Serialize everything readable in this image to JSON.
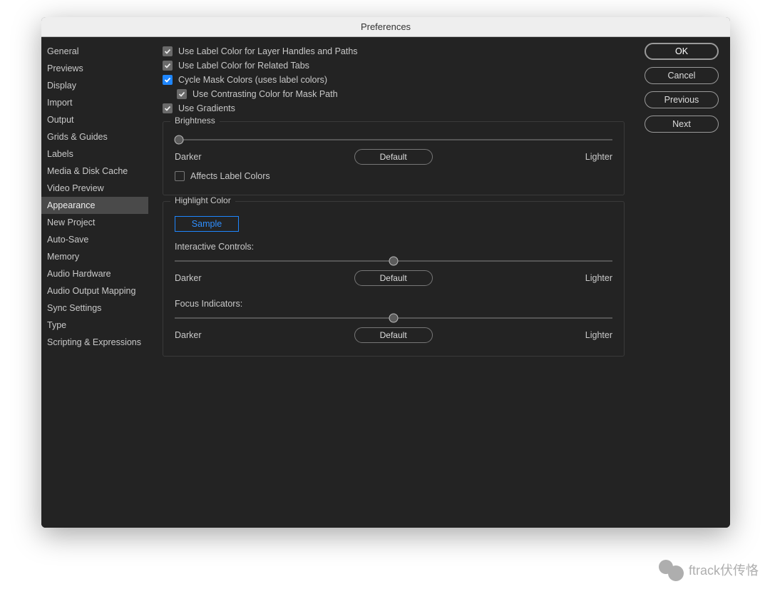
{
  "window": {
    "title": "Preferences"
  },
  "sidebar": {
    "items": [
      {
        "label": "General"
      },
      {
        "label": "Previews"
      },
      {
        "label": "Display"
      },
      {
        "label": "Import"
      },
      {
        "label": "Output"
      },
      {
        "label": "Grids & Guides"
      },
      {
        "label": "Labels"
      },
      {
        "label": "Media & Disk Cache"
      },
      {
        "label": "Video Preview"
      },
      {
        "label": "Appearance"
      },
      {
        "label": "New Project"
      },
      {
        "label": "Auto-Save"
      },
      {
        "label": "Memory"
      },
      {
        "label": "Audio Hardware"
      },
      {
        "label": "Audio Output Mapping"
      },
      {
        "label": "Sync Settings"
      },
      {
        "label": "Type"
      },
      {
        "label": "Scripting & Expressions"
      }
    ],
    "selected_index": 9
  },
  "buttons": {
    "ok": "OK",
    "cancel": "Cancel",
    "previous": "Previous",
    "next": "Next"
  },
  "checkboxes": {
    "label_handles": {
      "label": "Use Label Color for Layer Handles and Paths",
      "checked": true,
      "style": "gray"
    },
    "label_tabs": {
      "label": "Use Label Color for Related Tabs",
      "checked": true,
      "style": "gray"
    },
    "cycle_mask": {
      "label": "Cycle Mask Colors (uses label colors)",
      "checked": true,
      "style": "blue"
    },
    "contrast_mask": {
      "label": "Use Contrasting Color for Mask Path",
      "checked": true,
      "style": "gray"
    },
    "gradients": {
      "label": "Use Gradients",
      "checked": true,
      "style": "gray"
    },
    "affects_label": {
      "label": "Affects Label Colors",
      "checked": false
    }
  },
  "brightness": {
    "legend": "Brightness",
    "darker": "Darker",
    "lighter": "Lighter",
    "default": "Default",
    "value_percent": 1
  },
  "highlight": {
    "legend": "Highlight Color",
    "sample": "Sample",
    "interactive_label": "Interactive Controls:",
    "focus_label": "Focus Indicators:",
    "darker": "Darker",
    "lighter": "Lighter",
    "default": "Default",
    "interactive_value_percent": 50,
    "focus_value_percent": 50
  },
  "watermark": {
    "text": "ftrack伏传恪"
  }
}
